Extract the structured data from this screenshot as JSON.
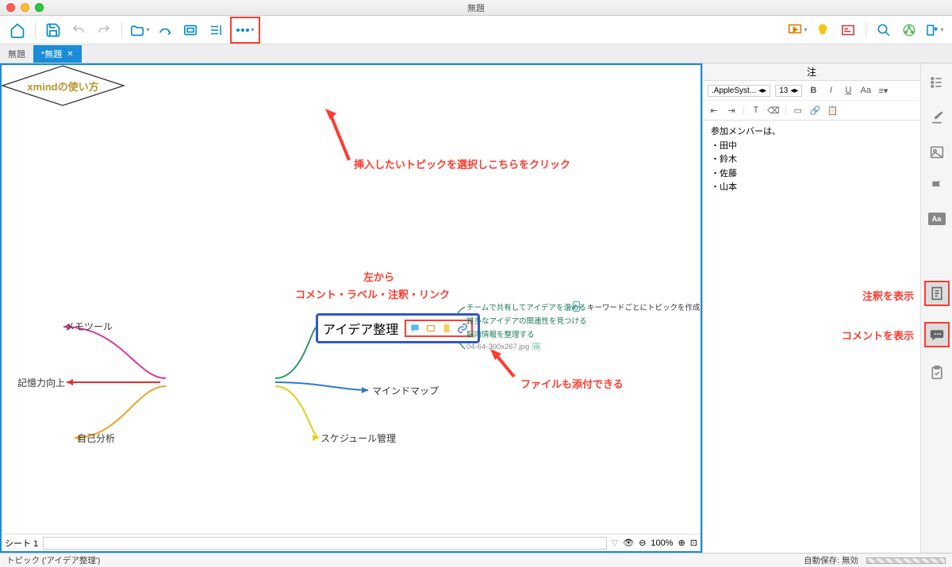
{
  "window": {
    "title": "無題"
  },
  "tabs": {
    "inactive": "無題",
    "active": "*無題"
  },
  "annotations": {
    "insert": "挿入したいトピックを選択しこちらをクリック",
    "left_from": "左から",
    "icons_list": "コメント・ラベル・注釈・リンク",
    "attach": "ファイルも添付できる",
    "show_notes": "注釈を表示",
    "show_comments": "コメントを表示"
  },
  "mindmap": {
    "central": "xmindの使い方",
    "branches": {
      "memo": "メモツール",
      "memory": "記憶力向上",
      "self": "自己分析",
      "idea": "アイデア整理",
      "mind": "マインドマップ",
      "schedule": "スケジュール管理"
    },
    "sub": {
      "a": "チームで共有してアイデアを温める",
      "b": "雑多なアイデアの関連性を見つける",
      "c": "脳内情報を整理する",
      "attach": "04-64-300x267.jpg",
      "kw": "キーワードごとにトピックを作成"
    }
  },
  "notes": {
    "title": "注",
    "font": ".AppleSyst...",
    "size": "13",
    "body0": "参加メンバーは、",
    "body1": "・田中",
    "body2": "・鈴木",
    "body3": "・佐藤",
    "body4": "・山本"
  },
  "sheet": {
    "label": "シート 1"
  },
  "zoom": "100%",
  "status": {
    "topic": "トピック ('アイデア整理')",
    "autosave": "自動保存: 無効"
  }
}
